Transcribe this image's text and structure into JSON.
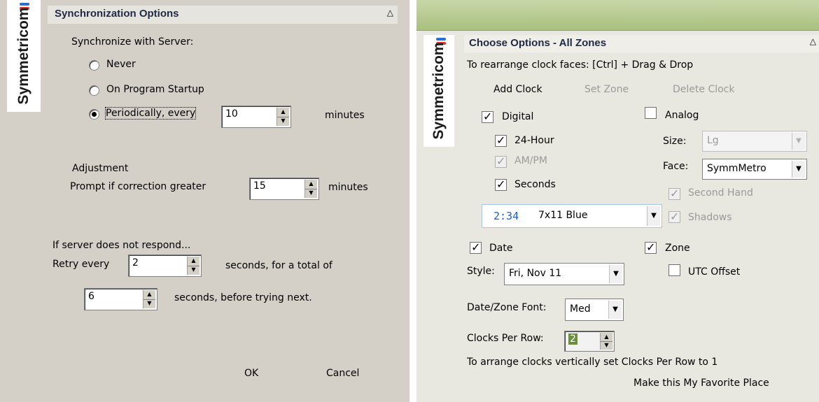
{
  "brand": "Symmetricom",
  "sync": {
    "title": "Synchronization Options",
    "sync_label": "Synchronize with Server:",
    "options": [
      "Never",
      "On Program Startup",
      "Periodically, every"
    ],
    "selected": 2,
    "period_value": "10",
    "period_unit": "minutes",
    "adjustment_heading": "Adjustment",
    "prompt_label": "Prompt if correction greater",
    "prompt_value": "15",
    "prompt_unit": "minutes",
    "no_response_label": "If server does not respond...",
    "retry_label": "Retry every",
    "retry_value": "2",
    "retry_suffix": "seconds, for a total of",
    "total_value": "6",
    "total_suffix": "seconds, before trying next.",
    "ok_label": "OK",
    "cancel_label": "Cancel"
  },
  "clock": {
    "title": "Choose Options - All Zones",
    "hint": "To rearrange clock faces: [Ctrl] + Drag & Drop",
    "add_clock": "Add Clock",
    "set_zone": "Set Zone",
    "delete_clock": "Delete Clock",
    "digital_label": "Digital",
    "hour24_label": "24-Hour",
    "ampm_label": "AM/PM",
    "seconds_label": "Seconds",
    "analog_label": "Analog",
    "size_label": "Size:",
    "size_value": "Lg",
    "face_label": "Face:",
    "face_value": "SymmMetro",
    "second_hand_label": "Second Hand",
    "shadows_label": "Shadows",
    "digital_style_preview": "2:34",
    "digital_style_name": "7x11 Blue",
    "digital_preview_color": "#1a5fd0",
    "date_label": "Date",
    "zone_label": "Zone",
    "style_label": "Style:",
    "style_value": "Fri, Nov 11",
    "utc_offset_label": "UTC Offset",
    "font_label": "Date/Zone Font:",
    "font_value": "Med",
    "per_row_label": "Clocks Per Row:",
    "per_row_value": "2",
    "arrange_hint": "To arrange clocks vertically set Clocks Per Row to 1",
    "favorite_label": "Make this My Favorite Place"
  }
}
